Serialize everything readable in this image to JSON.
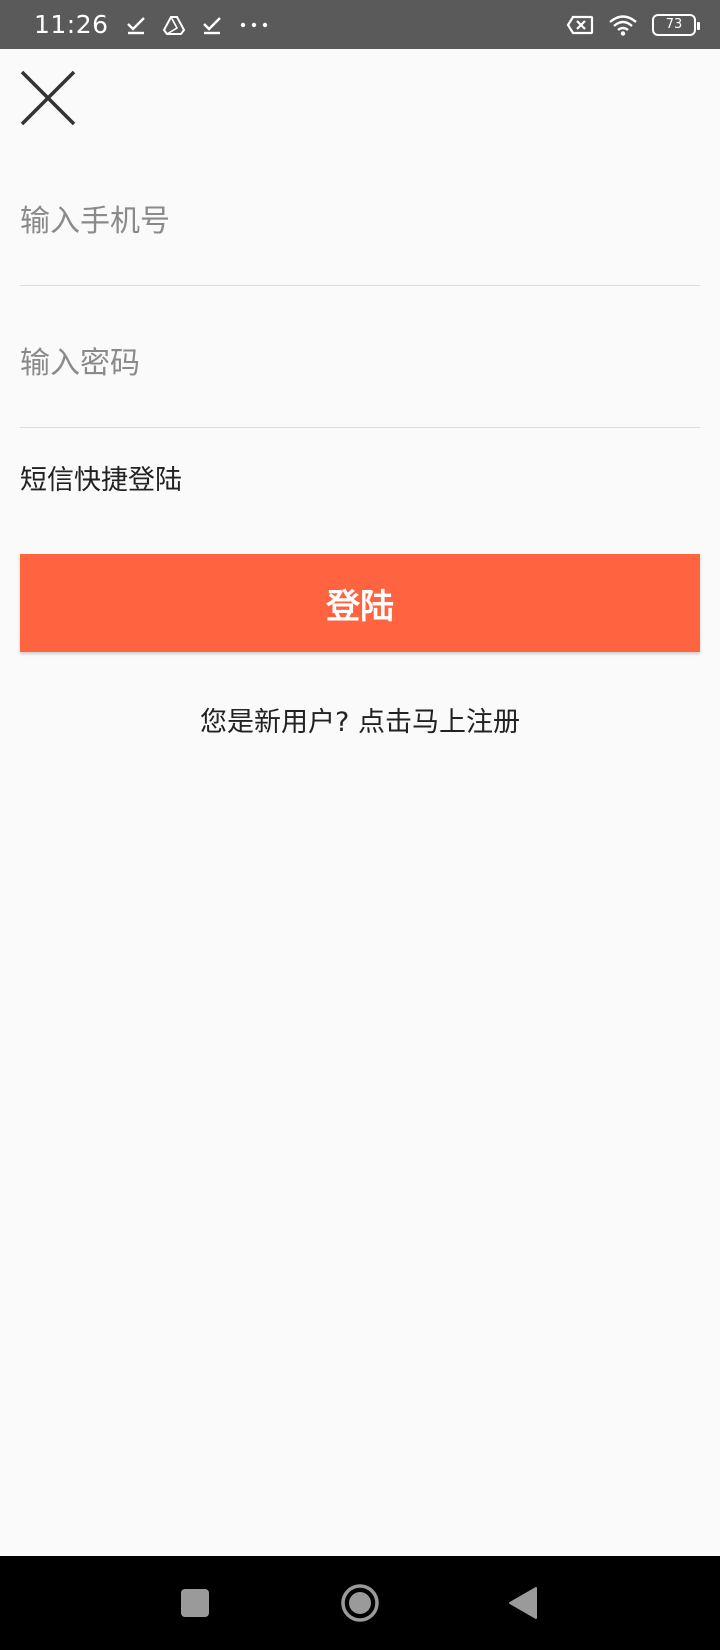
{
  "status_bar": {
    "time": "11:26",
    "left_icons": [
      "check-icon",
      "drive-icon",
      "check-icon",
      "more-dots-icon"
    ],
    "right_icons": [
      "no-sim-icon",
      "wifi-icon",
      "battery-icon"
    ],
    "battery_level": "73"
  },
  "form": {
    "phone_placeholder": "输入手机号",
    "password_placeholder": "输入密码",
    "sms_login_label": "短信快捷登陆",
    "login_button_label": "登陆",
    "register_prompt": "您是新用户? 点击马上注册"
  },
  "colors": {
    "accent": "#ff633f",
    "background": "#fafafa",
    "status_bar": "#5a5a5a",
    "nav_bar": "#000000"
  },
  "nav_bar": {
    "buttons": [
      "recents-icon",
      "home-icon",
      "back-icon"
    ]
  }
}
